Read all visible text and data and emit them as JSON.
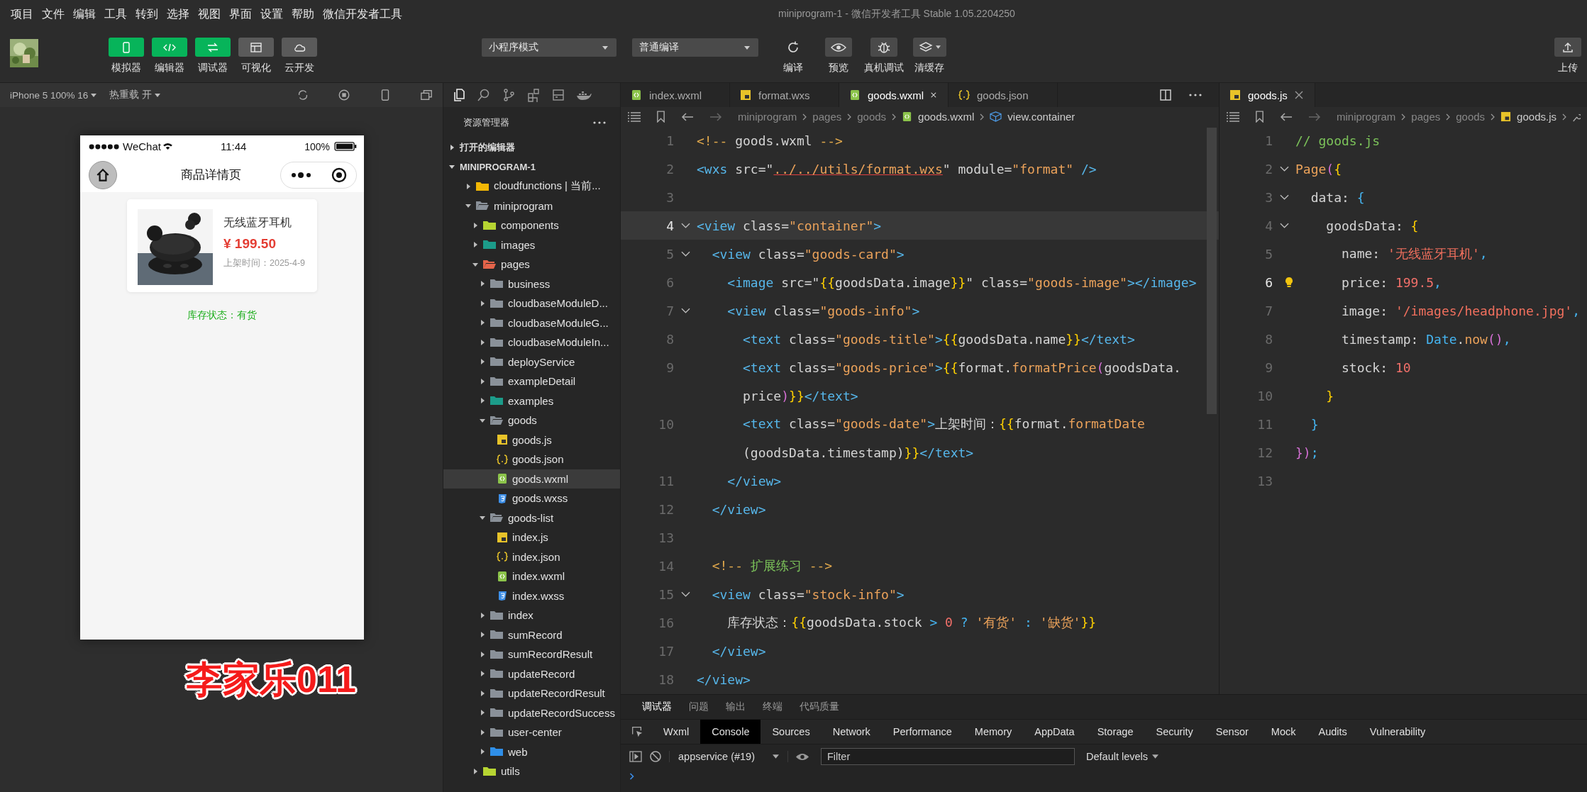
{
  "menu": [
    "项目",
    "文件",
    "编辑",
    "工具",
    "转到",
    "选择",
    "视图",
    "界面",
    "设置",
    "帮助",
    "微信开发者工具"
  ],
  "window": {
    "title": "miniprogram-1 - 微信开发者工具 Stable 1.05.2204250"
  },
  "toolbar": {
    "panels": [
      {
        "label": "模拟器",
        "kind": "phone",
        "on": true
      },
      {
        "label": "编辑器",
        "kind": "code",
        "on": true
      },
      {
        "label": "调试器",
        "kind": "switch",
        "on": true
      },
      {
        "label": "可视化",
        "kind": "layout",
        "on": false
      },
      {
        "label": "云开发",
        "kind": "cloud",
        "on": false
      }
    ],
    "mode": "小程序模式",
    "compile": "普通编译",
    "actions": [
      {
        "label": "编译",
        "kind": "refresh"
      },
      {
        "label": "预览",
        "kind": "eye"
      },
      {
        "label": "真机调试",
        "kind": "bug"
      },
      {
        "label": "清缓存",
        "kind": "layers"
      }
    ],
    "upload": "上传"
  },
  "simulator": {
    "device": "iPhone 5 100% 16",
    "hot_reload": "热重载 开",
    "phone": {
      "carrier": "WeChat",
      "time": "11:44",
      "battery": "100%",
      "title": "商品详情页",
      "product": {
        "name": "无线蓝牙耳机",
        "price": "¥ 199.50",
        "date": "上架时间：2025-4-9"
      },
      "stock": "库存状态：有货"
    },
    "annotation": "李家乐011"
  },
  "explorer": {
    "title": "资源管理器",
    "sections": [
      {
        "label": "打开的编辑器",
        "expanded": false
      },
      {
        "label": "MINIPROGRAM-1",
        "expanded": true
      }
    ],
    "items": [
      {
        "name": "cloudfunctions | 当前...",
        "kind": "cloud-folder",
        "expanded": false,
        "selected": false
      },
      {
        "name": "miniprogram",
        "kind": "folder",
        "expanded": true,
        "selected": false,
        "children": [
          {
            "name": "components",
            "kind": "components-folder",
            "expanded": false,
            "selected": false
          },
          {
            "name": "images",
            "kind": "images-folder",
            "expanded": false,
            "selected": false
          },
          {
            "name": "pages",
            "kind": "pages-folder",
            "expanded": true,
            "selected": false,
            "children": [
              {
                "name": "business",
                "kind": "folder",
                "expanded": false,
                "selected": false
              },
              {
                "name": "cloudbaseModuleD...",
                "kind": "folder",
                "expanded": false,
                "selected": false
              },
              {
                "name": "cloudbaseModuleG...",
                "kind": "folder",
                "expanded": false,
                "selected": false
              },
              {
                "name": "cloudbaseModuleIn...",
                "kind": "folder",
                "expanded": false,
                "selected": false
              },
              {
                "name": "deployService",
                "kind": "folder",
                "expanded": false,
                "selected": false
              },
              {
                "name": "exampleDetail",
                "kind": "folder",
                "expanded": false,
                "selected": false
              },
              {
                "name": "examples",
                "kind": "images-folder",
                "expanded": false,
                "selected": false
              },
              {
                "name": "goods",
                "kind": "folder",
                "expanded": true,
                "selected": false,
                "children": [
                  {
                    "name": "goods.js",
                    "kind": "js",
                    "selected": false
                  },
                  {
                    "name": "goods.json",
                    "kind": "json",
                    "selected": false
                  },
                  {
                    "name": "goods.wxml",
                    "kind": "wxml",
                    "selected": true
                  },
                  {
                    "name": "goods.wxss",
                    "kind": "wxss",
                    "selected": false
                  }
                ]
              },
              {
                "name": "goods-list",
                "kind": "folder",
                "expanded": true,
                "selected": false,
                "children": [
                  {
                    "name": "index.js",
                    "kind": "js",
                    "selected": false
                  },
                  {
                    "name": "index.json",
                    "kind": "json",
                    "selected": false
                  },
                  {
                    "name": "index.wxml",
                    "kind": "wxml",
                    "selected": false
                  },
                  {
                    "name": "index.wxss",
                    "kind": "wxss",
                    "selected": false
                  }
                ]
              },
              {
                "name": "index",
                "kind": "folder",
                "expanded": false,
                "selected": false
              },
              {
                "name": "sumRecord",
                "kind": "folder",
                "expanded": false,
                "selected": false
              },
              {
                "name": "sumRecordResult",
                "kind": "folder",
                "expanded": false,
                "selected": false
              },
              {
                "name": "updateRecord",
                "kind": "folder",
                "expanded": false,
                "selected": false
              },
              {
                "name": "updateRecordResult",
                "kind": "folder",
                "expanded": false,
                "selected": false
              },
              {
                "name": "updateRecordSuccess",
                "kind": "folder",
                "expanded": false,
                "selected": false
              },
              {
                "name": "user-center",
                "kind": "folder",
                "expanded": false,
                "selected": false
              },
              {
                "name": "web",
                "kind": "web-folder",
                "expanded": false,
                "selected": false
              }
            ]
          },
          {
            "name": "utils",
            "kind": "components-folder",
            "expanded": false,
            "selected": false
          }
        ]
      }
    ]
  },
  "editor": {
    "tabs": [
      {
        "label": "index.wxml",
        "kind": "wxml",
        "selected": false
      },
      {
        "label": "format.wxs",
        "kind": "js",
        "selected": false
      },
      {
        "label": "goods.wxml",
        "kind": "wxml",
        "selected": true
      },
      {
        "label": "goods.json",
        "kind": "json",
        "selected": false
      }
    ],
    "breadcrumb": [
      {
        "label": "miniprogram",
        "kind": "folder"
      },
      {
        "label": "pages",
        "kind": "folder"
      },
      {
        "label": "goods",
        "kind": "folder"
      },
      {
        "label": "goods.wxml",
        "kind": "wxml"
      },
      {
        "label": "view.container",
        "kind": "symbol"
      }
    ],
    "lines": [
      {
        "number": "1",
        "current": false,
        "foldable": false,
        "tokens": [
          {
            "text": "<!-- ",
            "kind": "cmark"
          },
          {
            "text": "goods.wxml",
            "kind": "plain"
          },
          {
            "text": " -->",
            "kind": "cmark"
          }
        ]
      },
      {
        "number": "2",
        "current": false,
        "foldable": false,
        "tokens": [
          {
            "text": "<wxs",
            "kind": "tag"
          },
          {
            "text": " src=\"",
            "kind": "attr"
          },
          {
            "text": "../../utils/format.wxs",
            "kind": "link"
          },
          {
            "text": "\" module=",
            "kind": "attr"
          },
          {
            "text": "\"format\"",
            "kind": "string"
          },
          {
            "text": " />",
            "kind": "tag"
          }
        ]
      },
      {
        "number": "3",
        "current": false,
        "foldable": false
      },
      {
        "number": "4",
        "current": true,
        "foldable": true,
        "tokens": [
          {
            "text": "<view",
            "kind": "tag"
          },
          {
            "text": " class=",
            "kind": "attr"
          },
          {
            "text": "\"container\"",
            "kind": "string"
          },
          {
            "text": ">",
            "kind": "tag"
          }
        ]
      },
      {
        "number": "5",
        "current": false,
        "foldable": true,
        "tokens": [
          {
            "text": "  <view",
            "kind": "tag"
          },
          {
            "text": " class=",
            "kind": "attr"
          },
          {
            "text": "\"goods-card\"",
            "kind": "string"
          },
          {
            "text": ">",
            "kind": "tag"
          }
        ]
      },
      {
        "number": "6",
        "current": false,
        "foldable": false,
        "tokens": [
          {
            "text": "    <image",
            "kind": "tag"
          },
          {
            "text": " src=\"",
            "kind": "attr"
          },
          {
            "text": "{{",
            "kind": "brace"
          },
          {
            "text": "goodsData.image",
            "kind": "plain"
          },
          {
            "text": "}}",
            "kind": "brace"
          },
          {
            "text": "\" class=",
            "kind": "attr"
          },
          {
            "text": "\"goods-image\"",
            "kind": "string"
          },
          {
            "text": "></image>",
            "kind": "tag"
          }
        ]
      },
      {
        "number": "7",
        "current": false,
        "foldable": true,
        "tokens": [
          {
            "text": "    <view",
            "kind": "tag"
          },
          {
            "text": " class=",
            "kind": "attr"
          },
          {
            "text": "\"goods-info\"",
            "kind": "string"
          },
          {
            "text": ">",
            "kind": "tag"
          }
        ]
      },
      {
        "number": "8",
        "current": false,
        "foldable": false,
        "tokens": [
          {
            "text": "      <text",
            "kind": "tag"
          },
          {
            "text": " class=",
            "kind": "attr"
          },
          {
            "text": "\"goods-title\"",
            "kind": "string"
          },
          {
            "text": ">",
            "kind": "tag"
          },
          {
            "text": "{{",
            "kind": "brace"
          },
          {
            "text": "goodsData.name",
            "kind": "plain"
          },
          {
            "text": "}}",
            "kind": "brace"
          },
          {
            "text": "</text>",
            "kind": "tag"
          }
        ]
      },
      {
        "number": "9",
        "current": false,
        "foldable": false,
        "tokens": [
          {
            "text": "      <text",
            "kind": "tag"
          },
          {
            "text": " class=",
            "kind": "attr"
          },
          {
            "text": "\"goods-price\"",
            "kind": "string"
          },
          {
            "text": ">",
            "kind": "tag"
          },
          {
            "text": "{{",
            "kind": "brace"
          },
          {
            "text": "format.",
            "kind": "plain"
          },
          {
            "text": "formatPrice",
            "kind": "fn"
          },
          {
            "text": "(",
            "kind": "paren"
          },
          {
            "text": "goodsData.",
            "kind": "plain"
          }
        ]
      },
      {
        "current": false,
        "foldable": false,
        "tokens": [
          {
            "text": "      price",
            "kind": "plain"
          },
          {
            "text": ")",
            "kind": "paren"
          },
          {
            "text": "}}",
            "kind": "brace"
          },
          {
            "text": "</text>",
            "kind": "tag"
          }
        ]
      },
      {
        "number": "10",
        "current": false,
        "foldable": false,
        "tokens": [
          {
            "text": "      <text",
            "kind": "tag"
          },
          {
            "text": " class=",
            "kind": "attr"
          },
          {
            "text": "\"goods-date\"",
            "kind": "string"
          },
          {
            "text": ">",
            "kind": "tag"
          },
          {
            "text": "上架时间：",
            "kind": "plain"
          },
          {
            "text": "{{",
            "kind": "brace"
          },
          {
            "text": "format.",
            "kind": "plain"
          },
          {
            "text": "formatDate",
            "kind": "fn"
          }
        ]
      },
      {
        "current": false,
        "foldable": false,
        "tokens": [
          {
            "text": "      (goodsData.timestamp)",
            "kind": "plain"
          },
          {
            "text": "}}",
            "kind": "brace"
          },
          {
            "text": "</text>",
            "kind": "tag"
          }
        ]
      },
      {
        "number": "11",
        "current": false,
        "foldable": false,
        "tokens": [
          {
            "text": "    </view>",
            "kind": "tag"
          }
        ]
      },
      {
        "number": "12",
        "current": false,
        "foldable": false,
        "tokens": [
          {
            "text": "  </view>",
            "kind": "tag"
          }
        ]
      },
      {
        "number": "13",
        "current": false,
        "foldable": false
      },
      {
        "number": "14",
        "current": false,
        "foldable": false,
        "tokens": [
          {
            "text": "  <!-- ",
            "kind": "cmark"
          },
          {
            "text": "扩展练习",
            "kind": "comment"
          },
          {
            "text": " -->",
            "kind": "cmark"
          }
        ]
      },
      {
        "number": "15",
        "current": false,
        "foldable": true,
        "tokens": [
          {
            "text": "  <view",
            "kind": "tag"
          },
          {
            "text": " class=",
            "kind": "attr"
          },
          {
            "text": "\"stock-info\"",
            "kind": "string"
          },
          {
            "text": ">",
            "kind": "tag"
          }
        ]
      },
      {
        "number": "16",
        "current": false,
        "foldable": false,
        "tokens": [
          {
            "text": "    库存状态：",
            "kind": "plain"
          },
          {
            "text": "{{",
            "kind": "brace"
          },
          {
            "text": "goodsData.stock ",
            "kind": "plain"
          },
          {
            "text": ">",
            "kind": "op"
          },
          {
            "text": " 0",
            "kind": "num"
          },
          {
            "text": " ? ",
            "kind": "op"
          },
          {
            "text": "'有货'",
            "kind": "string"
          },
          {
            "text": " : ",
            "kind": "op"
          },
          {
            "text": "'缺货'",
            "kind": "string"
          },
          {
            "text": "}}",
            "kind": "brace"
          }
        ]
      },
      {
        "number": "17",
        "current": false,
        "foldable": false,
        "tokens": [
          {
            "text": "  </view>",
            "kind": "tag"
          }
        ]
      },
      {
        "number": "18",
        "current": false,
        "foldable": false,
        "tokens": [
          {
            "text": "</view>",
            "kind": "tag"
          }
        ]
      }
    ]
  },
  "side_editor": {
    "tabs": [
      {
        "label": "goods.js",
        "kind": "js",
        "selected": true
      }
    ],
    "breadcrumb": [
      {
        "label": "miniprogram",
        "kind": "folder"
      },
      {
        "label": "pages",
        "kind": "folder"
      },
      {
        "label": "goods",
        "kind": "folder"
      },
      {
        "label": "goods.js",
        "kind": "js"
      }
    ],
    "lines": [
      {
        "number": "1",
        "current": false,
        "foldable": false,
        "lightbulb": false,
        "tokens": [
          {
            "text": "// goods.js",
            "kind": "comment"
          }
        ]
      },
      {
        "number": "2",
        "current": false,
        "foldable": true,
        "lightbulb": false,
        "tokens": [
          {
            "text": "Page",
            "kind": "fn"
          },
          {
            "text": "(",
            "kind": "paren"
          },
          {
            "text": "{",
            "kind": "brace"
          }
        ]
      },
      {
        "number": "3",
        "current": false,
        "foldable": true,
        "lightbulb": false,
        "tokens": [
          {
            "text": "  data: ",
            "kind": "plain"
          },
          {
            "text": "{",
            "kind": "op"
          }
        ]
      },
      {
        "number": "4",
        "current": false,
        "foldable": true,
        "lightbulb": false,
        "tokens": [
          {
            "text": "    goodsData: ",
            "kind": "plain"
          },
          {
            "text": "{",
            "kind": "brace"
          }
        ]
      },
      {
        "number": "5",
        "current": false,
        "foldable": false,
        "lightbulb": false,
        "tokens": [
          {
            "text": "      name: ",
            "kind": "plain"
          },
          {
            "text": "'无线蓝牙耳机'",
            "kind": "jsstr"
          },
          {
            "text": ",",
            "kind": "op"
          }
        ]
      },
      {
        "number": "6",
        "current": true,
        "foldable": false,
        "lightbulb": true,
        "tokens": [
          {
            "text": "      price: ",
            "kind": "plain"
          },
          {
            "text": "199.5",
            "kind": "num"
          },
          {
            "text": ",",
            "kind": "op"
          }
        ]
      },
      {
        "number": "7",
        "current": false,
        "foldable": false,
        "lightbulb": false,
        "tokens": [
          {
            "text": "      image: ",
            "kind": "plain"
          },
          {
            "text": "'/images/headphone.jpg'",
            "kind": "jsstr"
          },
          {
            "text": ",",
            "kind": "op"
          }
        ]
      },
      {
        "number": "8",
        "current": false,
        "foldable": false,
        "lightbulb": false,
        "tokens": [
          {
            "text": "      timestamp: ",
            "kind": "plain"
          },
          {
            "text": "Date",
            "kind": "op"
          },
          {
            "text": ".",
            "kind": "plain"
          },
          {
            "text": "now",
            "kind": "fn"
          },
          {
            "text": "()",
            "kind": "paren"
          },
          {
            "text": ",",
            "kind": "op"
          }
        ]
      },
      {
        "number": "9",
        "current": false,
        "foldable": false,
        "lightbulb": false,
        "tokens": [
          {
            "text": "      stock: ",
            "kind": "plain"
          },
          {
            "text": "10",
            "kind": "num"
          }
        ]
      },
      {
        "number": "10",
        "current": false,
        "foldable": false,
        "lightbulb": false,
        "tokens": [
          {
            "text": "    }",
            "kind": "brace"
          }
        ]
      },
      {
        "number": "11",
        "current": false,
        "foldable": false,
        "lightbulb": false,
        "tokens": [
          {
            "text": "  }",
            "kind": "op"
          }
        ]
      },
      {
        "number": "12",
        "current": false,
        "foldable": false,
        "lightbulb": false,
        "tokens": [
          {
            "text": "})",
            "kind": "paren"
          },
          {
            "text": ";",
            "kind": "op"
          }
        ]
      },
      {
        "number": "13",
        "current": false,
        "foldable": false,
        "lightbulb": false
      }
    ]
  },
  "debug": {
    "tabs": [
      {
        "label": "调试器",
        "selected": true
      },
      {
        "label": "问题",
        "selected": false
      },
      {
        "label": "输出",
        "selected": false
      },
      {
        "label": "终端",
        "selected": false
      },
      {
        "label": "代码质量",
        "selected": false
      }
    ],
    "devtools_tabs": [
      {
        "label": "Wxml",
        "selected": false
      },
      {
        "label": "Console",
        "selected": true
      },
      {
        "label": "Sources",
        "selected": false
      },
      {
        "label": "Network",
        "selected": false
      },
      {
        "label": "Performance",
        "selected": false
      },
      {
        "label": "Memory",
        "selected": false
      },
      {
        "label": "AppData",
        "selected": false
      },
      {
        "label": "Storage",
        "selected": false
      },
      {
        "label": "Security",
        "selected": false
      },
      {
        "label": "Sensor",
        "selected": false
      },
      {
        "label": "Mock",
        "selected": false
      },
      {
        "label": "Audits",
        "selected": false
      },
      {
        "label": "Vulnerability",
        "selected": false
      }
    ],
    "context": "appservice (#19)",
    "filter": {
      "placeholder": "Filter"
    },
    "levels": "Default levels"
  }
}
